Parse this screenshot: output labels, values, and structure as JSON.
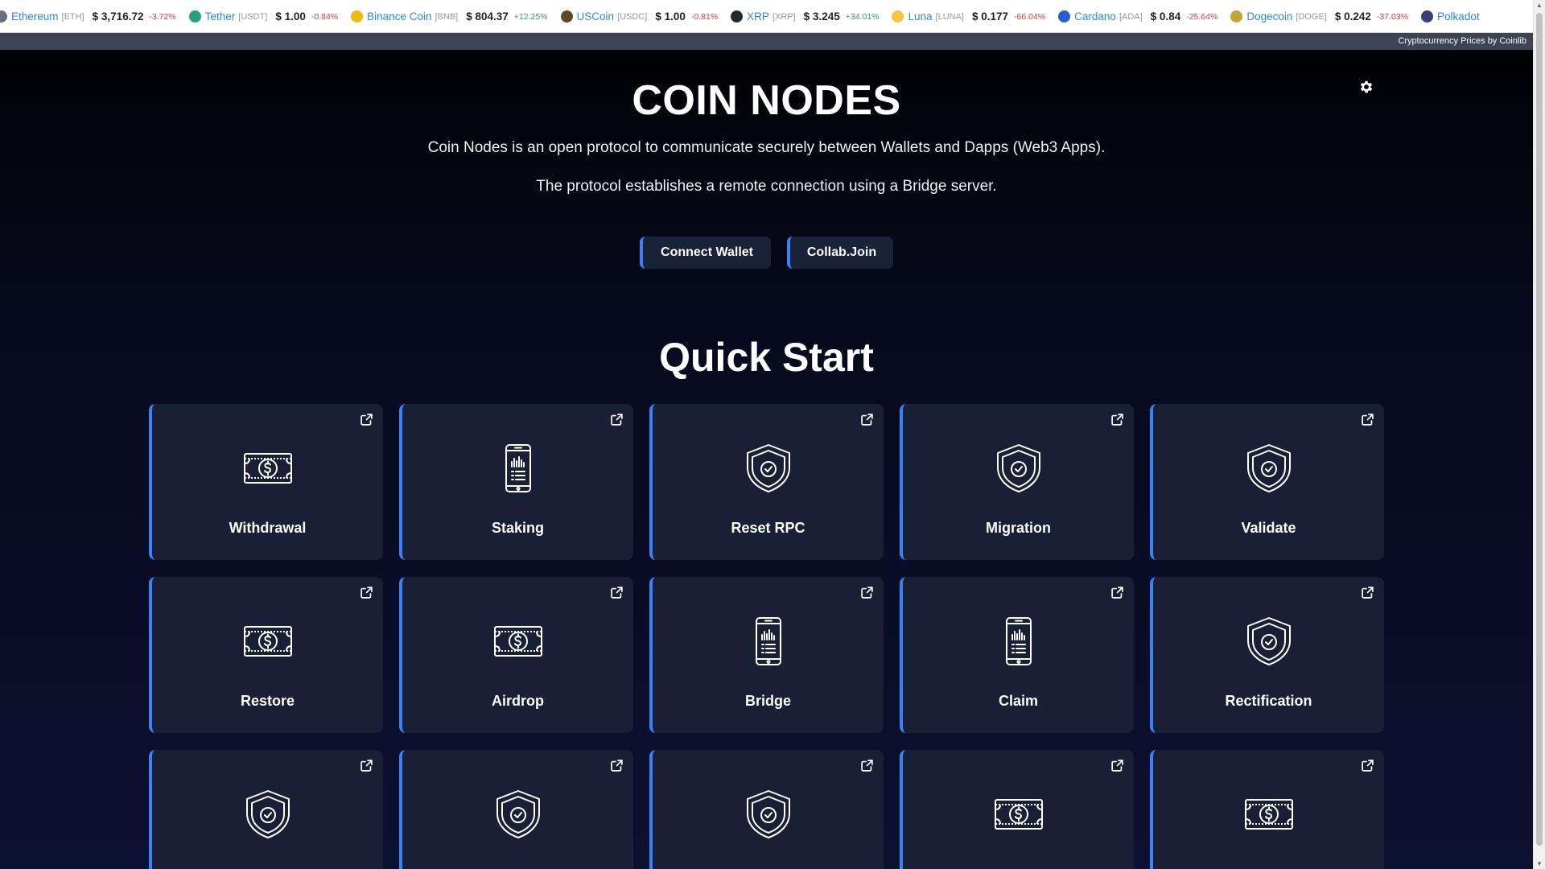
{
  "ticker": {
    "coins": [
      {
        "name": "Ethereum",
        "symbol": "[ETH]",
        "price": "$ 3,716.72",
        "change": "-3.72%",
        "dir": "neg",
        "color": "#6b6f7d",
        "icon": "ethereum-icon"
      },
      {
        "name": "Tether",
        "symbol": "[USDT]",
        "price": "$ 1.00",
        "change": "-0.84%",
        "dir": "neg",
        "color": "#26a17b",
        "icon": "tether-icon"
      },
      {
        "name": "Binance Coin",
        "symbol": "[BNB]",
        "price": "$ 804.37",
        "change": "+12.25%",
        "dir": "pos",
        "color": "#f0b90b",
        "icon": "binance-coin-icon"
      },
      {
        "name": "USCoin",
        "symbol": "[USDC]",
        "price": "$ 1.00",
        "change": "-0.81%",
        "dir": "neg",
        "color": "#5a4a2a",
        "icon": "uscoin-icon"
      },
      {
        "name": "XRP",
        "symbol": "[XRP]",
        "price": "$ 3.245",
        "change": "+34.01%",
        "dir": "pos",
        "color": "#23292f",
        "icon": "xrp-icon"
      },
      {
        "name": "Luna",
        "symbol": "[LUNA]",
        "price": "$ 0.177",
        "change": "-66.04%",
        "dir": "neg",
        "color": "#f9c33a",
        "icon": "luna-icon"
      },
      {
        "name": "Cardano",
        "symbol": "[ADA]",
        "price": "$ 0.84",
        "change": "-25.64%",
        "dir": "neg",
        "color": "#2a5bd8",
        "icon": "cardano-icon"
      },
      {
        "name": "Dogecoin",
        "symbol": "[DOGE]",
        "price": "$ 0.242",
        "change": "-37.03%",
        "dir": "neg",
        "color": "#c2a633",
        "icon": "dogecoin-icon"
      },
      {
        "name": "Polkadot",
        "symbol": "",
        "price": "",
        "change": "",
        "dir": "neg",
        "color": "#3a3f7a",
        "icon": "polkadot-icon"
      }
    ],
    "credit": "Cryptocurrency Prices by Coinlib"
  },
  "hero": {
    "title": "COIN NODES",
    "subtitle1": "Coin Nodes is an open protocol to communicate securely between Wallets and Dapps (Web3 Apps).",
    "subtitle2": "The protocol establishes a remote connection using a Bridge server.",
    "connect_label": "Connect Wallet",
    "collab_label": "Collab.Join",
    "settings_icon": "gear-icon"
  },
  "quickstart": {
    "title": "Quick Start",
    "cards": [
      {
        "label": "Withdrawal",
        "icon": "money-bill"
      },
      {
        "label": "Staking",
        "icon": "phone"
      },
      {
        "label": "Reset RPC",
        "icon": "shield"
      },
      {
        "label": "Migration",
        "icon": "shield"
      },
      {
        "label": "Validate",
        "icon": "shield"
      },
      {
        "label": "Restore",
        "icon": "money-bill"
      },
      {
        "label": "Airdrop",
        "icon": "money-bill"
      },
      {
        "label": "Bridge",
        "icon": "phone"
      },
      {
        "label": "Claim",
        "icon": "phone"
      },
      {
        "label": "Rectification",
        "icon": "shield"
      },
      {
        "label": "",
        "icon": "shield"
      },
      {
        "label": "",
        "icon": "shield"
      },
      {
        "label": "",
        "icon": "shield"
      },
      {
        "label": "",
        "icon": "money-bill"
      },
      {
        "label": "",
        "icon": "money-bill"
      }
    ]
  }
}
